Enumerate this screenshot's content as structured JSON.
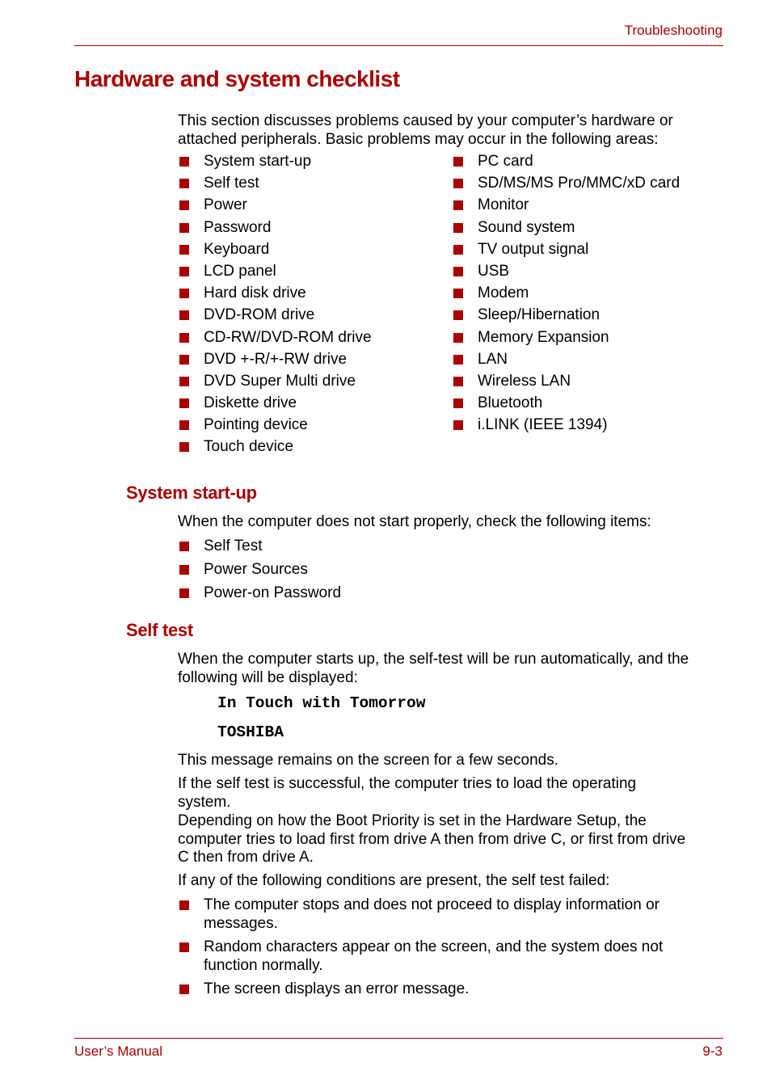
{
  "header": {
    "section": "Troubleshooting"
  },
  "title": "Hardware and system checklist",
  "intro": "This section discusses problems caused by your computer’s hardware or attached  peripherals. Basic problems may occur in the following areas:",
  "areas_left": [
    "System start-up",
    "Self test",
    "Power",
    "Password",
    "Keyboard",
    "LCD panel",
    "Hard disk drive",
    "DVD-ROM drive",
    "CD-RW/DVD-ROM drive",
    "DVD +-R/+-RW drive",
    "DVD Super Multi drive",
    "Diskette drive",
    "Pointing device",
    "Touch device"
  ],
  "areas_right": [
    "PC card",
    "SD/MS/MS Pro/MMC/xD card",
    "Monitor",
    "Sound system",
    "TV output signal",
    "USB",
    "Modem",
    "Sleep/Hibernation",
    "Memory Expansion",
    "LAN",
    "Wireless LAN",
    "Bluetooth",
    "i.LINK (IEEE 1394)"
  ],
  "system_startup": {
    "heading": "System start-up",
    "text": "When the computer does not start properly, check the following items:",
    "items": [
      "Self Test",
      "Power Sources",
      "Power-on Password"
    ]
  },
  "self_test": {
    "heading": "Self test",
    "text": "When the computer starts up, the self-test will be run automatically, and the following will be displayed:",
    "display_line1": "In Touch with Tomorrow",
    "display_line2": "TOSHIBA",
    "p1": "This message remains on the screen for a few seconds.",
    "p2": "If the self test is successful, the computer tries to load the operating system.",
    "p3": "Depending on how the Boot Priority is set in the Hardware Setup, the computer tries to load first from drive A then from drive C, or first from drive C then from drive A.",
    "p4": "If any of the following conditions are present, the self test failed:",
    "failures": [
      "The computer stops and does not proceed to display information or messages.",
      "Random characters appear on the screen, and the system does not function  normally.",
      "The screen displays an error message."
    ]
  },
  "footer": {
    "left": "User’s Manual",
    "right": "9-3"
  },
  "colors": {
    "accent": "#a80000"
  }
}
